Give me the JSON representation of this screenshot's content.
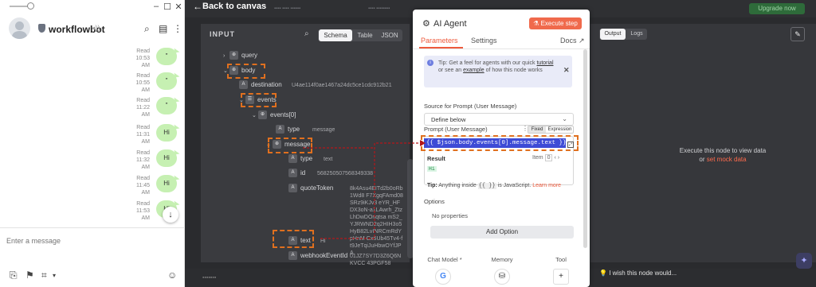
{
  "chat": {
    "bot_name": "workflowbot",
    "messages": [
      {
        "status": "Read",
        "time": "10:53 AM",
        "text": "\""
      },
      {
        "status": "Read",
        "time": "10:55 AM",
        "text": "\""
      },
      {
        "status": "Read",
        "time": "11:22 AM",
        "text": "\""
      },
      {
        "status": "Read",
        "time": "11:31 AM",
        "text": "Hi"
      },
      {
        "status": "Read",
        "time": "11:32 AM",
        "text": "Hi"
      },
      {
        "status": "Read",
        "time": "11:45 AM",
        "text": "Hi"
      },
      {
        "status": "Read",
        "time": "11:53 AM",
        "text": "Hi"
      }
    ],
    "composer_placeholder": "Enter a message"
  },
  "editor": {
    "back_label": "Back to canvas",
    "upgrade_label": "Upgrade now",
    "input_title": "INPUT",
    "input_tabs": [
      "Schema",
      "Table",
      "JSON"
    ],
    "active_input_tab": "Schema",
    "tree": {
      "query": "query",
      "body": "body",
      "destination_key": "destination",
      "destination_value": "U4ae114f0ae1467a24dc5ce1cdc912b21",
      "events": "events",
      "events0": "events[0]",
      "type_key": "type",
      "type_value": "message",
      "message": "message",
      "msg_type_key": "type",
      "msg_type_value": "text",
      "id_key": "id",
      "id_value": "568250507568349338",
      "quote_key": "quoteToken",
      "quote_value": "8k4Asu4BITd2b0oRb1Wd8 F7XgqFAmd08SRz9iKJv3 eYR_HFDX3oN-a1LAwrh_ZtzLhDwDOnqtsa mS2_YJRWND2q2HIH3o5 HyB82LvINRCmRdYpHnM Gx6Ub45Tv4-ft9JeTqiJuHbwOYfJPA",
      "text_key": "text",
      "text_value": "Hi",
      "webhook_key": "webhookEventId",
      "webhook_value": "01JZ7SY7D3Z6Q6NKVCC 43PGF58",
      "badge_object": "⊕",
      "badge_array": "☰",
      "badge_string": "A"
    },
    "output_tabs": [
      "Output",
      "Logs"
    ],
    "active_output_tab": "Output",
    "exec_message": "Execute this node to view data",
    "exec_or": "or",
    "exec_link": "set mock data",
    "wish_text": "I wish this node would..."
  },
  "modal": {
    "title": "AI Agent",
    "execute_label": "Execute step",
    "tabs": [
      "Parameters",
      "Settings"
    ],
    "active_tab": "Parameters",
    "docs_label": "Docs",
    "tip_text_1": "Tip: Get a feel for agents with our quick",
    "tip_link_1": "tutorial",
    "tip_text_2": "or see an",
    "tip_link_2": "example",
    "tip_text_3": "of how this node works",
    "source_label": "Source for Prompt (User Message)",
    "source_value": "Define below",
    "prompt_label": "Prompt (User Message)",
    "fixed_label": "Fixed",
    "expression_label": "Expression",
    "expression_value": "{{ $json.body.events[0].message.text }}",
    "result_label": "Result",
    "item_label": "Item",
    "item_value": "0",
    "result_value": "Hi",
    "tip2_bold": "Tip:",
    "tip2_text": "Anything inside",
    "tip2_code": "{{ }}",
    "tip2_text2": "is JavaScript.",
    "tip2_link": "Learn more",
    "options_label": "Options",
    "no_properties": "No properties",
    "add_option_label": "Add Option",
    "sub_nodes": [
      "Chat Model *",
      "Memory",
      "Tool"
    ]
  },
  "colors": {
    "accent": "#ee5a3c",
    "highlight": "#e0701f",
    "bubble": "#c6f0b2",
    "arrow": "#b3171b",
    "expression_bg": "#3d4bd6"
  }
}
